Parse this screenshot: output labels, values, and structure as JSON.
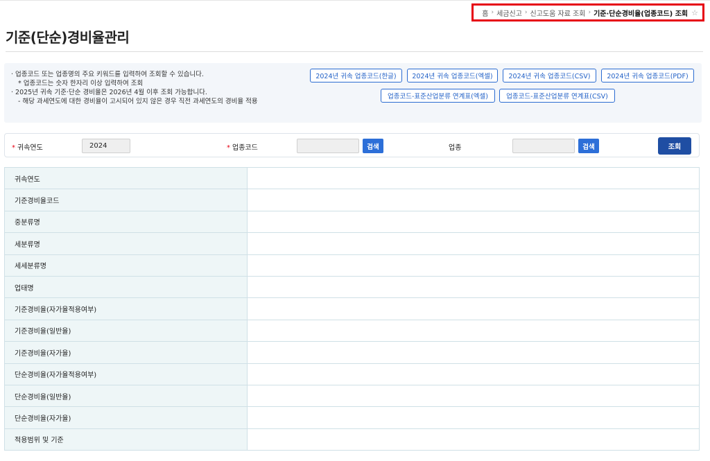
{
  "breadcrumb": {
    "items": [
      "홈",
      "세금신고",
      "신고도움 자료 조회"
    ],
    "current": "기준·단순경비율(업종코드) 조회",
    "star_icon": "star-outline-icon"
  },
  "page": {
    "title": "기준(단순)경비율관리"
  },
  "notice": {
    "lines": [
      "· 업종코드 또는 업종명의 주요 키워드를 입력하여 조회할 수 있습니다.",
      "* 업종코드는 숫자 한자리 이상 입력하여 조회",
      "· 2025년 귀속 기준·단순 경비율은 2026년 4월 이후 조회 가능합니다.",
      "- 해당 과세연도에 대한 경비율이 고시되어 있지 않은 경우 직전 과세연도의 경비율 적용"
    ]
  },
  "downloads": [
    "2024년 귀속 업종코드(한글)",
    "2024년 귀속 업종코드(엑셀)",
    "2024년 귀속 업종코드(CSV)",
    "2024년 귀속 업종코드(PDF)",
    "업종코드-표준산업분류 연계표(엑셀)",
    "업종코드-표준산업분류 연계표(CSV)"
  ],
  "search": {
    "year_label": "귀속연도",
    "year_value": "2024",
    "code_label": "업종코드",
    "code_value": "",
    "industry_label": "업종",
    "industry_value": "",
    "search_btn": "검색",
    "query_btn": "조회",
    "required_mark": "*"
  },
  "result_rows": [
    "귀속연도",
    "기준경비율코드",
    "중분류명",
    "세분류명",
    "세세분류명",
    "업태명",
    "기준경비율(자가율적용여부)",
    "기준경비율(일반율)",
    "기준경비율(자가율)",
    "단순경비율(자가율적용여부)",
    "단순경비율(일반율)",
    "단순경비율(자가율)",
    "적용범위 및 기준"
  ],
  "colors": {
    "accent": "#2d6fd8",
    "query": "#1f4ea3",
    "highlight": "#e60012"
  }
}
